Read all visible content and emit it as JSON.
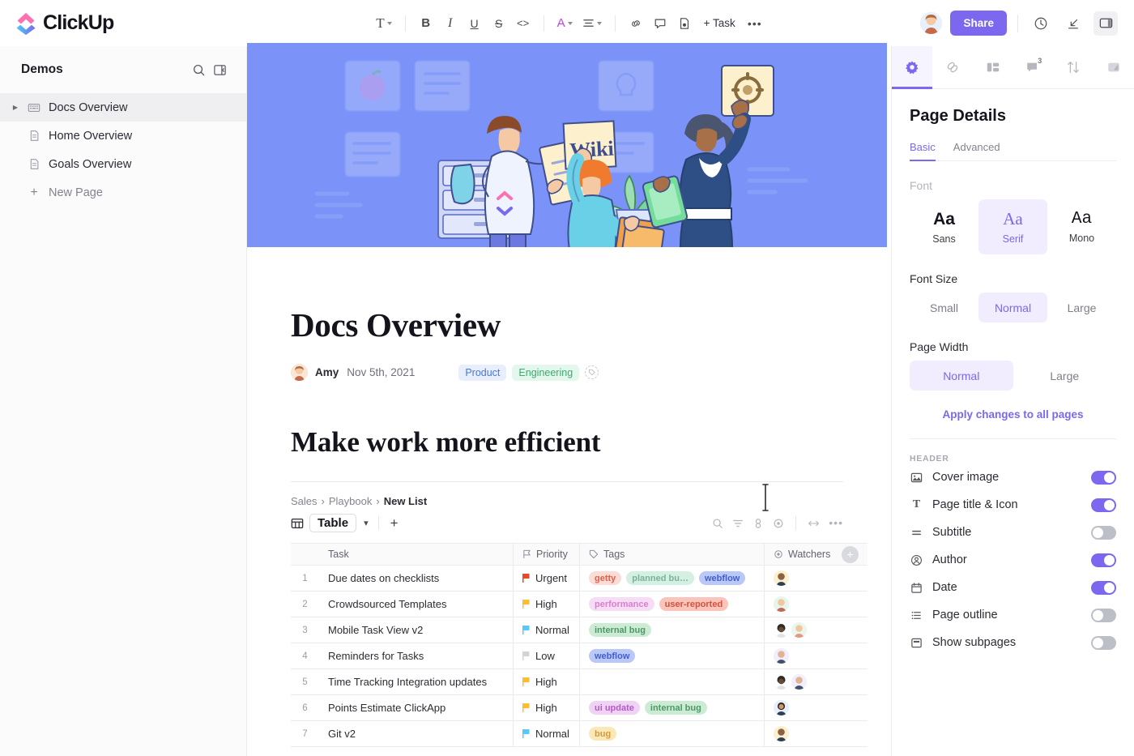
{
  "app": {
    "name": "ClickUp"
  },
  "toolbar": {
    "text_style": "T",
    "bold": "B",
    "italic": "I",
    "underline": "U",
    "strike": "S",
    "code": "<>",
    "color": "A",
    "align": "align-icon",
    "link": "link-icon",
    "comment": "comment-icon",
    "page": "page-icon",
    "task": "+ Task",
    "more": "•••"
  },
  "topright": {
    "share": "Share",
    "history_icon": "clock-icon",
    "collapse_icon": "collapse-icon",
    "panel_icon": "panel-icon"
  },
  "sidebar": {
    "title": "Demos",
    "search_icon": "search-icon",
    "collapse_icon": "sidebar-collapse-icon",
    "items": [
      {
        "label": "Docs Overview",
        "icon": "doc-grid-icon",
        "active": true,
        "expandable": true
      },
      {
        "label": "Home Overview",
        "icon": "page-icon",
        "active": false,
        "expandable": false
      },
      {
        "label": "Goals Overview",
        "icon": "page-icon",
        "active": false,
        "expandable": false
      },
      {
        "label": "New Page",
        "icon": "plus-icon",
        "active": false,
        "expandable": false,
        "muted": true
      }
    ]
  },
  "doc": {
    "title": "Docs Overview",
    "author": "Amy",
    "date": "Nov 5th, 2021",
    "tags": [
      {
        "label": "Product",
        "bg": "#e8eefc",
        "fg": "#4b77d8"
      },
      {
        "label": "Engineering",
        "bg": "#e4f7ec",
        "fg": "#3bab6d"
      }
    ],
    "heading2": "Make work more efficient",
    "breadcrumb": {
      "parts": [
        "Sales",
        "Playbook"
      ],
      "current": "New List",
      "sep": "›"
    },
    "view": {
      "name": "Table",
      "plus": "+"
    },
    "view_tools": [
      "search-icon",
      "filter-icon",
      "group-icon",
      "eye-icon",
      "resize-icon",
      "more-icon"
    ],
    "table": {
      "columns": [
        {
          "label": "Task",
          "icon": ""
        },
        {
          "label": "Priority",
          "icon": "flag-icon"
        },
        {
          "label": "Tags",
          "icon": "tag-icon"
        },
        {
          "label": "Watchers",
          "icon": "eye-icon"
        }
      ],
      "add_column": "+",
      "rows": [
        {
          "idx": "1",
          "task": "Due dates on checklists",
          "priority": "Urgent",
          "flag": "#e3492b",
          "tags": [
            {
              "label": "getty",
              "bg": "#fcdcd6",
              "fg": "#e0604a"
            },
            {
              "label": "planned bu…",
              "bg": "#d4f0e2",
              "fg": "#79b29b"
            },
            {
              "label": "webflow",
              "bg": "#b9c8f7",
              "fg": "#3f5fd0"
            }
          ],
          "watchers": 1
        },
        {
          "idx": "2",
          "task": "Crowdsourced Templates",
          "priority": "High",
          "flag": "#ffbb33",
          "tags": [
            {
              "label": "performance",
              "bg": "#f7dcf5",
              "fg": "#d87fd0"
            },
            {
              "label": "user-reported",
              "bg": "#fbc4bb",
              "fg": "#d4513c"
            }
          ],
          "watchers": 1
        },
        {
          "idx": "3",
          "task": "Mobile Task View v2",
          "priority": "Normal",
          "flag": "#5cc6f5",
          "tags": [
            {
              "label": "internal bug",
              "bg": "#cdebd4",
              "fg": "#4a9a64"
            }
          ],
          "watchers": 2
        },
        {
          "idx": "4",
          "task": "Reminders for Tasks",
          "priority": "Low",
          "flag": "#d3d4d8",
          "tags": [
            {
              "label": "webflow",
              "bg": "#b9c8f7",
              "fg": "#3f5fd0"
            }
          ],
          "watchers": 1
        },
        {
          "idx": "5",
          "task": "Time Tracking Integration updates",
          "priority": "High",
          "flag": "#ffbb33",
          "tags": [],
          "watchers": 2
        },
        {
          "idx": "6",
          "task": "Points Estimate ClickApp",
          "priority": "High",
          "flag": "#ffbb33",
          "tags": [
            {
              "label": "ui update",
              "bg": "#f0d2f5",
              "fg": "#b25bc4"
            },
            {
              "label": "internal bug",
              "bg": "#cdebd4",
              "fg": "#4a9a64"
            }
          ],
          "watchers": 1
        },
        {
          "idx": "7",
          "task": "Git v2",
          "priority": "Normal",
          "flag": "#5cc6f5",
          "tags": [
            {
              "label": "bug",
              "bg": "#fbe8b8",
              "fg": "#d39b3a"
            }
          ],
          "watchers": 1
        }
      ]
    }
  },
  "panel": {
    "tabs": [
      {
        "icon": "gear-icon",
        "active": true,
        "badge": ""
      },
      {
        "icon": "link-icon",
        "active": false,
        "badge": ""
      },
      {
        "icon": "layout-icon",
        "active": false,
        "badge": ""
      },
      {
        "icon": "comment-icon",
        "active": false,
        "badge": "3"
      },
      {
        "icon": "sort-icon",
        "active": false,
        "badge": ""
      },
      {
        "icon": "expand-icon",
        "active": false,
        "badge": ""
      }
    ],
    "title": "Page Details",
    "subtabs": [
      {
        "label": "Basic",
        "active": true
      },
      {
        "label": "Advanced",
        "active": false
      }
    ],
    "font_label": "Font",
    "fonts": [
      {
        "sample": "Aa",
        "name": "Sans",
        "selected": false
      },
      {
        "sample": "Aa",
        "name": "Serif",
        "selected": true
      },
      {
        "sample": "Aa",
        "name": "Mono",
        "selected": false
      }
    ],
    "font_size_label": "Font Size",
    "font_sizes": [
      {
        "label": "Small",
        "selected": false
      },
      {
        "label": "Normal",
        "selected": true
      },
      {
        "label": "Large",
        "selected": false
      }
    ],
    "page_width_label": "Page Width",
    "page_widths": [
      {
        "label": "Normal",
        "selected": true
      },
      {
        "label": "Large",
        "selected": false
      }
    ],
    "apply_all": "Apply changes to all pages",
    "header_section": "HEADER",
    "header_toggles": [
      {
        "label": "Cover image",
        "icon": "image-icon",
        "on": true
      },
      {
        "label": "Page title & Icon",
        "icon": "title-icon",
        "on": true
      },
      {
        "label": "Subtitle",
        "icon": "subtitle-icon",
        "on": false
      },
      {
        "label": "Author",
        "icon": "person-icon",
        "on": true
      },
      {
        "label": "Date",
        "icon": "calendar-icon",
        "on": true
      },
      {
        "label": "Page outline",
        "icon": "list-icon",
        "on": false
      },
      {
        "label": "Show subpages",
        "icon": "subpages-icon",
        "on": false
      }
    ]
  },
  "colors": {
    "accent": "#7b68ee",
    "cover_bg": "#7b93f8"
  }
}
